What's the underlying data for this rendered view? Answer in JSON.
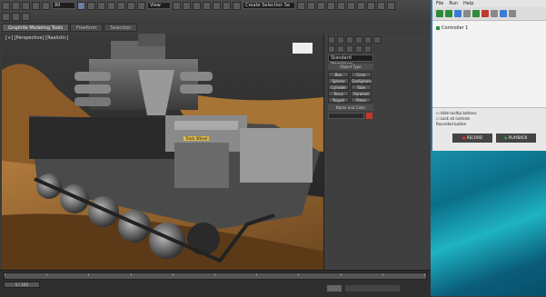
{
  "toolbar": {
    "selection_filter": "All",
    "view_dropdown": "View",
    "selection_set": "Create Selection Se"
  },
  "tabs": [
    {
      "label": "Graphite Modeling Tools"
    },
    {
      "label": "Freeform"
    },
    {
      "label": "Selection"
    }
  ],
  "viewport": {
    "label": "[+] [Perspective] [Realistic]",
    "callout": "Track Wheel"
  },
  "command_panel": {
    "dropdown": "Standard Primitives",
    "rollout_object_type": "Object Type",
    "rollout_name_color": "Name and Color",
    "object_buttons": [
      "Box",
      "Cone",
      "Sphere",
      "GeoSphere",
      "Cylinder",
      "Tube",
      "Torus",
      "Pyramid",
      "Teapot",
      "Plane"
    ]
  },
  "timeline": {
    "frame_counter": "0 / 100",
    "ticks": [
      "0",
      "10",
      "20",
      "30",
      "40",
      "50",
      "60",
      "70",
      "80",
      "90",
      "100"
    ]
  },
  "right_app": {
    "menu": [
      "File",
      "Run",
      "Help"
    ],
    "tree_item": "Controller 1",
    "checkbox_1": "Hide tooltip buttons",
    "checkbox_2": "Lock all controls",
    "label": "Recorded button",
    "record_button": "RECORD",
    "play_button": "PLAYBACK"
  }
}
